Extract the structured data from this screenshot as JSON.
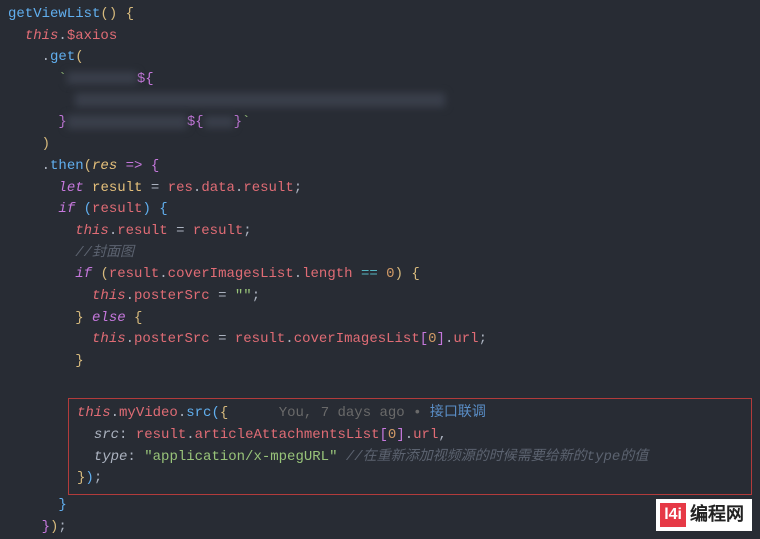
{
  "code": {
    "fn_name": "getViewList",
    "axios": "$axios",
    "get": "get",
    "then": "then",
    "res": "res",
    "arrow": "=>",
    "let": "let",
    "result_var": "result",
    "data": "data",
    "result_prop": "result",
    "if": "if",
    "this": "this",
    "cmt_cover": "//封面图",
    "coverImagesList": "coverImagesList",
    "length": "length",
    "eq": "==",
    "zero": "0",
    "posterSrc": "posterSrc",
    "empty": "\"\"",
    "else": "else",
    "url": "url",
    "myVideo": "myVideo",
    "srcFn": "src",
    "srcKey": "src",
    "articleAttachmentsList": "articleAttachmentsList",
    "typeKey": "type",
    "typeVal": "\"application/x-mpegURL\"",
    "cmt_type": "//在重新添加视频源的时候需要给新的type的值"
  },
  "blame": {
    "prefix": "You, 7 days ago • ",
    "link": "接口联调"
  },
  "watermark": {
    "logo": "l4i",
    "text": "编程网"
  }
}
